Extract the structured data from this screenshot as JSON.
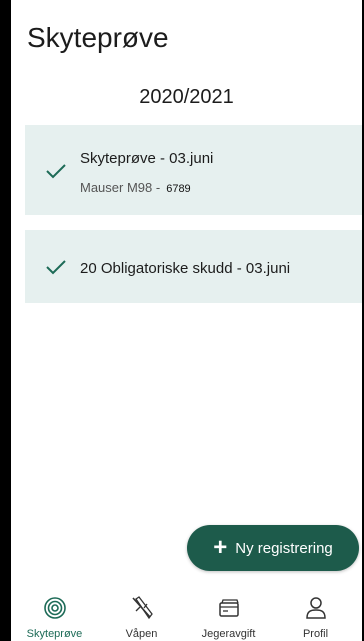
{
  "header": {
    "title": "Skyteprøve"
  },
  "season": "2020/2021",
  "records": [
    {
      "title": "Skyteprøve - 03.juni",
      "weapon": "Mauser M98 -",
      "serial": "6789",
      "status_icon": "check-icon"
    },
    {
      "title": "20 Obligatoriske skudd - 03.juni",
      "status_icon": "check-icon"
    }
  ],
  "fab": {
    "label": "Ny registrering",
    "icon": "plus-icon"
  },
  "nav": {
    "items": [
      {
        "label": "Skyteprøve",
        "icon": "target-icon",
        "active": true
      },
      {
        "label": "Våpen",
        "icon": "rifle-icon",
        "active": false
      },
      {
        "label": "Jegeravgift",
        "icon": "card-icon",
        "active": false
      },
      {
        "label": "Profil",
        "icon": "person-icon",
        "active": false
      }
    ]
  },
  "colors": {
    "primary": "#1d5b4b",
    "active_nav": "#1d6b57",
    "card_background": "#e6f0ef",
    "check": "#1d6b57"
  }
}
